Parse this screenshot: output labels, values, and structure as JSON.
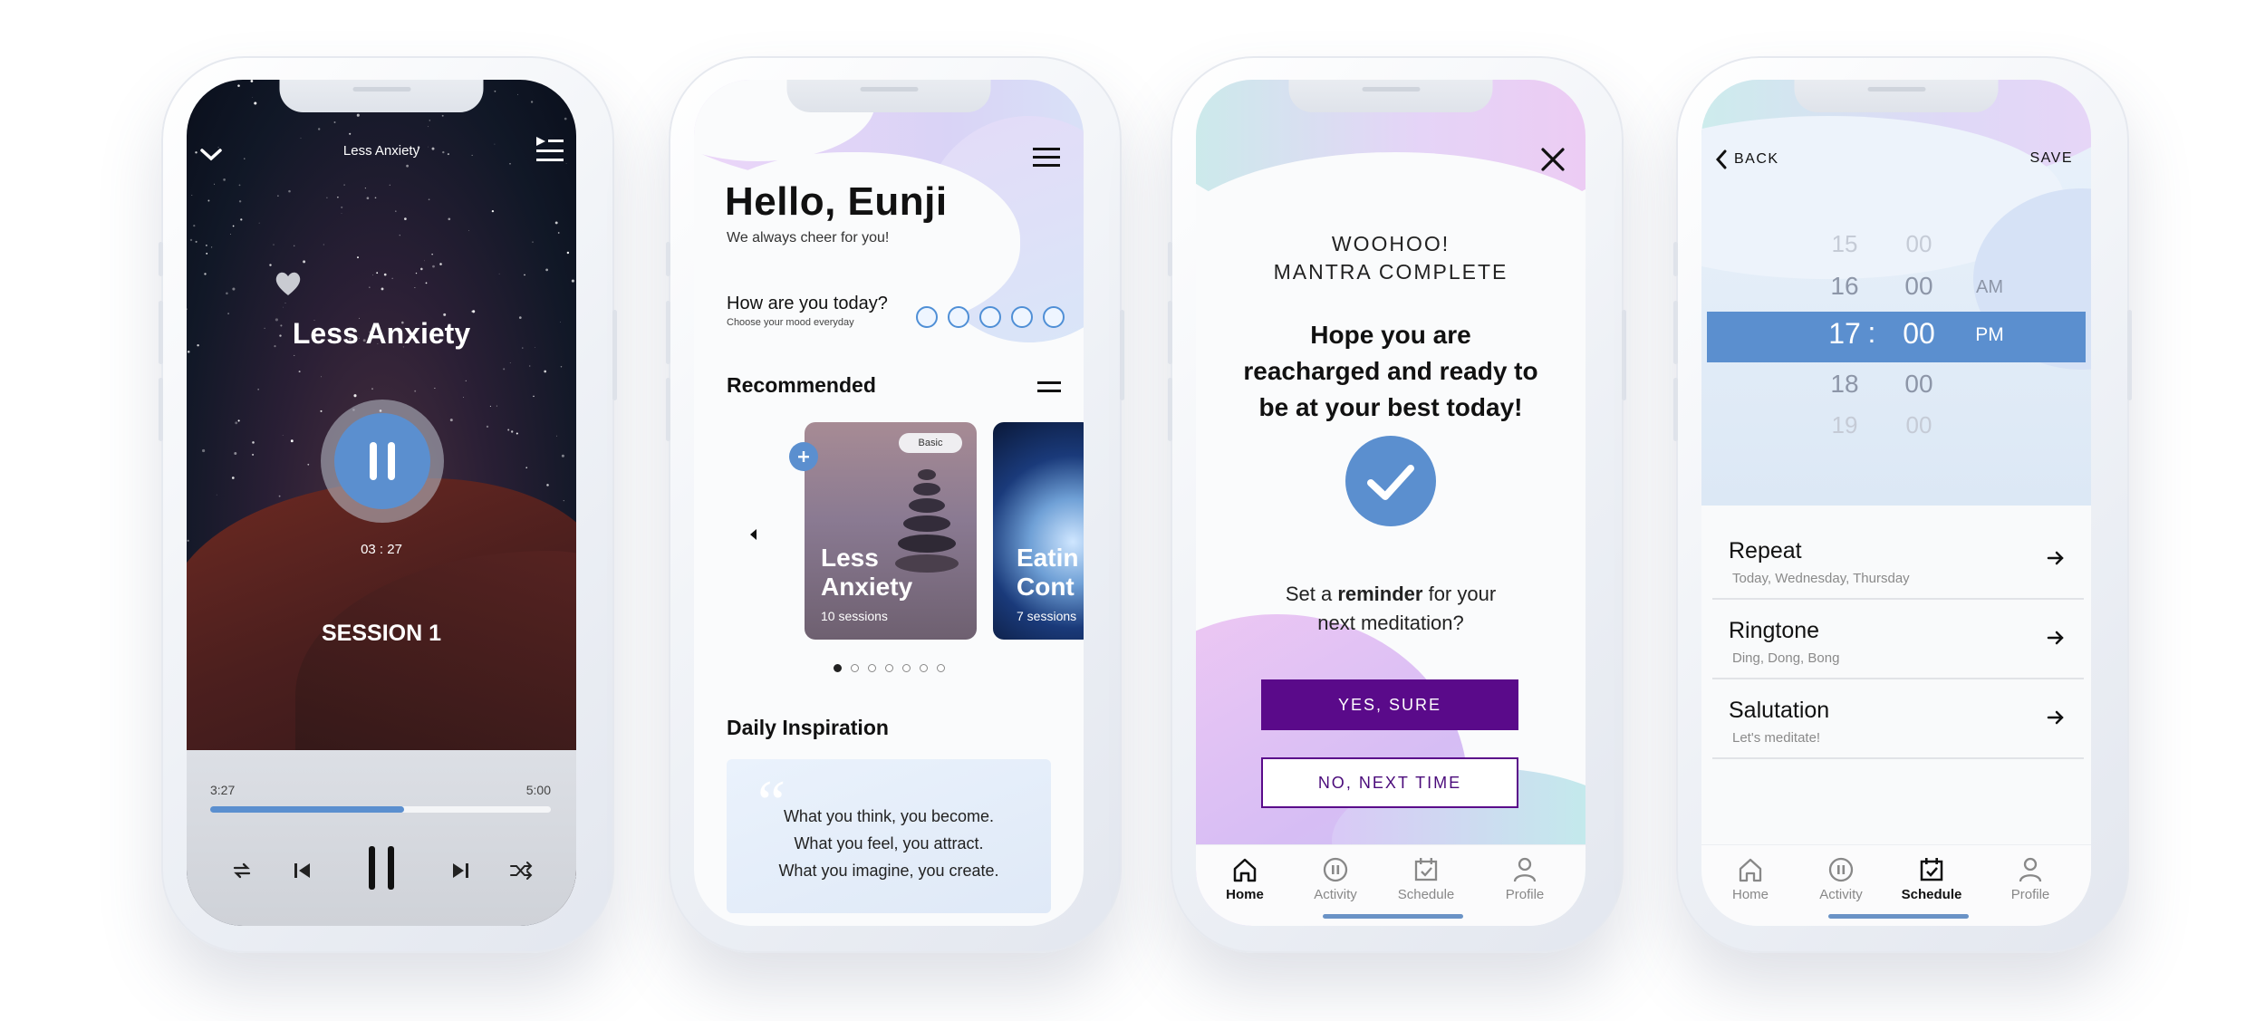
{
  "player": {
    "title": "Less Anxiety",
    "track_name": "Less Anxiety",
    "timer": "03 : 27",
    "session": "SESSION 1",
    "time_elapsed": "3:27",
    "time_total": "5:00",
    "progress": 0.57
  },
  "home": {
    "greeting": "Hello, Eunji",
    "subtitle": "We always cheer for you!",
    "mood_question": "How are you today?",
    "mood_hint": "Choose your mood everyday",
    "recommended": "Recommended",
    "card1": {
      "badge": "Basic",
      "title_line1": "Less",
      "title_line2": "Anxiety",
      "sessions": "10 sessions"
    },
    "card2": {
      "title_line1": "Eatin",
      "title_line2": "Cont",
      "sessions": "7 sessions"
    },
    "daily_title": "Daily Inspiration",
    "quote": [
      "What you think, you become.",
      "What you feel, you attract.",
      "What you imagine, you create."
    ]
  },
  "complete": {
    "heading_line1": "WOOHOO!",
    "heading_line2": "MANTRA COMPLETE",
    "message_lines": [
      "Hope you are",
      "reacharged and ready to",
      "be at your best today!"
    ],
    "reminder_pre": "Set a ",
    "reminder_bold": "reminder",
    "reminder_post": " for your",
    "reminder_line2": "next meditation?",
    "yes_label": "YES, SURE",
    "no_label": "NO, NEXT TIME"
  },
  "schedule": {
    "back_label": "BACK",
    "save_label": "SAVE",
    "hours": [
      "15",
      "16",
      "17",
      "18",
      "19"
    ],
    "minutes": [
      "00",
      "00",
      "00",
      "00",
      "00"
    ],
    "ampm": [
      "AM",
      "PM"
    ],
    "separator": ":",
    "rows": [
      {
        "title": "Repeat",
        "sub": "Today, Wednesday, Thursday"
      },
      {
        "title": "Ringtone",
        "sub": "Ding, Dong, Bong"
      },
      {
        "title": "Salutation",
        "sub": "Let's meditate!"
      }
    ]
  },
  "tabs": [
    "Home",
    "Activity",
    "Schedule",
    "Profile"
  ],
  "colors": {
    "accent_blue": "#5b8fcf",
    "purple": "#5a0a8a",
    "lavender": "#e9c9f5",
    "mint": "#c8f0ec"
  }
}
